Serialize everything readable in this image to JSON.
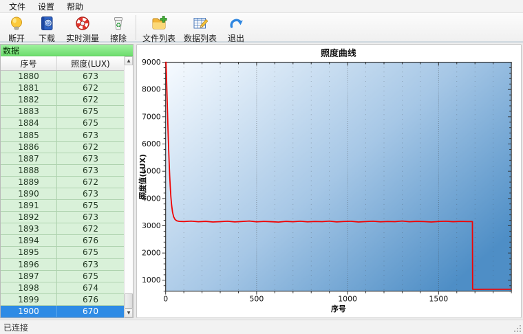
{
  "menu": {
    "items": [
      {
        "name": "file",
        "label": "文件"
      },
      {
        "name": "settings",
        "label": "设置"
      },
      {
        "name": "help",
        "label": "帮助"
      }
    ]
  },
  "toolbar": {
    "items": [
      {
        "name": "disconnect",
        "label": "断开",
        "icon": "bulb-icon"
      },
      {
        "name": "download",
        "label": "下载",
        "icon": "address-book-icon"
      },
      {
        "name": "realtime-measure",
        "label": "实时测量",
        "icon": "lifebuoy-icon"
      },
      {
        "name": "erase",
        "label": "擦除",
        "icon": "recycle-bin-icon"
      },
      {
        "name": "file-list",
        "label": "文件列表",
        "icon": "folder-add-icon"
      },
      {
        "name": "data-list",
        "label": "数据列表",
        "icon": "data-table-icon"
      },
      {
        "name": "exit",
        "label": "退出",
        "icon": "exit-arrow-icon"
      }
    ],
    "separator_after_index": 3
  },
  "data_panel": {
    "title": "数据",
    "columns": [
      "序号",
      "照度(LUX)"
    ],
    "rows": [
      [
        1880,
        673
      ],
      [
        1881,
        672
      ],
      [
        1882,
        672
      ],
      [
        1883,
        675
      ],
      [
        1884,
        675
      ],
      [
        1885,
        673
      ],
      [
        1886,
        672
      ],
      [
        1887,
        673
      ],
      [
        1888,
        673
      ],
      [
        1889,
        672
      ],
      [
        1890,
        673
      ],
      [
        1891,
        675
      ],
      [
        1892,
        673
      ],
      [
        1893,
        672
      ],
      [
        1894,
        676
      ],
      [
        1895,
        675
      ],
      [
        1896,
        673
      ],
      [
        1897,
        675
      ],
      [
        1898,
        674
      ],
      [
        1899,
        676
      ],
      [
        1900,
        670
      ]
    ],
    "selected_serial": 1900
  },
  "status_bar": {
    "text": "已连接"
  },
  "chart_data": {
    "type": "line",
    "title": "照度曲线",
    "xlabel": "序号",
    "ylabel": "照度值(LUX)",
    "xlim": [
      0,
      1900
    ],
    "ylim": [
      600,
      9000
    ],
    "x_ticks": [
      0,
      500,
      1000,
      1500
    ],
    "y_ticks": [
      1000,
      2000,
      3000,
      4000,
      5000,
      6000,
      7000,
      8000,
      9000
    ],
    "x_minor_step": 100,
    "y_minor_step": 200,
    "grid": "vertical-dotted",
    "plot_bg_gradient": [
      "#f7fbff",
      "#a6c7e6",
      "#4e8ec6"
    ],
    "line_color": "#f00404",
    "series": [
      {
        "name": "照度",
        "points": [
          [
            0,
            8950
          ],
          [
            2,
            9000
          ],
          [
            4,
            8600
          ],
          [
            7,
            7900
          ],
          [
            10,
            7200
          ],
          [
            13,
            6500
          ],
          [
            16,
            5900
          ],
          [
            19,
            5350
          ],
          [
            22,
            4850
          ],
          [
            25,
            4450
          ],
          [
            29,
            4050
          ],
          [
            33,
            3750
          ],
          [
            38,
            3500
          ],
          [
            44,
            3330
          ],
          [
            52,
            3230
          ],
          [
            62,
            3180
          ],
          [
            75,
            3160
          ],
          [
            100,
            3155
          ],
          [
            140,
            3170
          ],
          [
            180,
            3148
          ],
          [
            220,
            3162
          ],
          [
            260,
            3138
          ],
          [
            300,
            3152
          ],
          [
            340,
            3168
          ],
          [
            380,
            3142
          ],
          [
            420,
            3158
          ],
          [
            460,
            3172
          ],
          [
            500,
            3146
          ],
          [
            540,
            3160
          ],
          [
            580,
            3150
          ],
          [
            620,
            3136
          ],
          [
            660,
            3162
          ],
          [
            700,
            3148
          ],
          [
            740,
            3166
          ],
          [
            780,
            3144
          ],
          [
            820,
            3158
          ],
          [
            860,
            3152
          ],
          [
            900,
            3170
          ],
          [
            940,
            3142
          ],
          [
            980,
            3156
          ],
          [
            1020,
            3164
          ],
          [
            1060,
            3140
          ],
          [
            1100,
            3154
          ],
          [
            1140,
            3168
          ],
          [
            1180,
            3146
          ],
          [
            1220,
            3158
          ],
          [
            1260,
            3152
          ],
          [
            1300,
            3172
          ],
          [
            1340,
            3148
          ],
          [
            1380,
            3162
          ],
          [
            1420,
            3154
          ],
          [
            1460,
            3140
          ],
          [
            1500,
            3158
          ],
          [
            1540,
            3166
          ],
          [
            1580,
            3150
          ],
          [
            1620,
            3160
          ],
          [
            1660,
            3154
          ],
          [
            1686,
            3155
          ],
          [
            1687,
            670
          ],
          [
            1720,
            668
          ],
          [
            1760,
            672
          ],
          [
            1800,
            669
          ],
          [
            1840,
            672
          ],
          [
            1870,
            670
          ],
          [
            1900,
            670
          ]
        ]
      }
    ]
  }
}
